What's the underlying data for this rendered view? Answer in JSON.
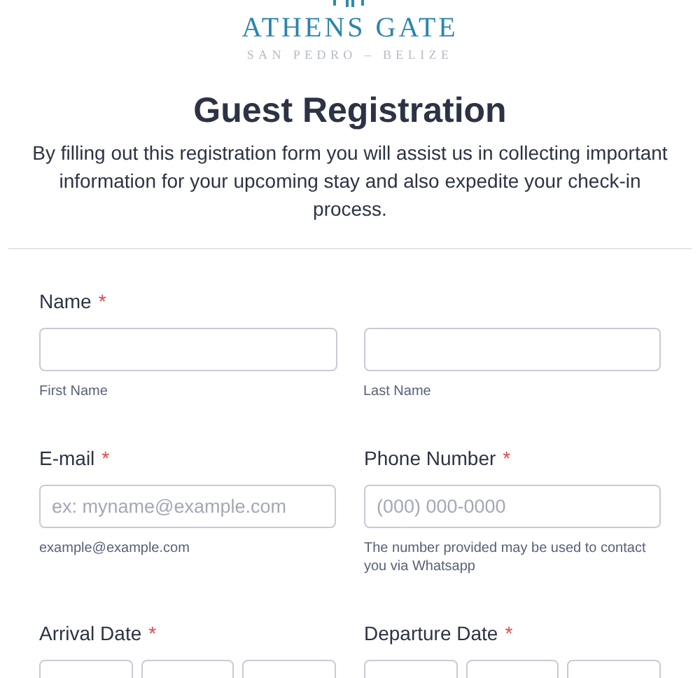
{
  "logo": {
    "name": "ATHENS GATE",
    "tagline": "SAN PEDRO – BELIZE"
  },
  "header": {
    "title": "Guest Registration",
    "description": "By filling out this registration form you will assist us in collecting important information for your upcoming stay and also expedite your check-in process."
  },
  "fields": [
    {
      "kind": "name",
      "label": "Name",
      "required_mark": "*",
      "inputs": [
        {
          "sublabel": "First Name"
        },
        {
          "sublabel": "Last Name"
        }
      ]
    },
    {
      "kind": "text",
      "label": "E-mail",
      "required_mark": "*",
      "placeholder": "ex: myname@example.com",
      "sublabel": "example@example.com"
    },
    {
      "kind": "text",
      "label": "Phone Number",
      "required_mark": "*",
      "placeholder": "(000) 000-0000",
      "sublabel": "The number provided may be used to contact you via Whatsapp"
    },
    {
      "kind": "date",
      "label": "Arrival Date",
      "required_mark": "*"
    },
    {
      "kind": "date",
      "label": "Departure Date",
      "required_mark": "*"
    }
  ]
}
